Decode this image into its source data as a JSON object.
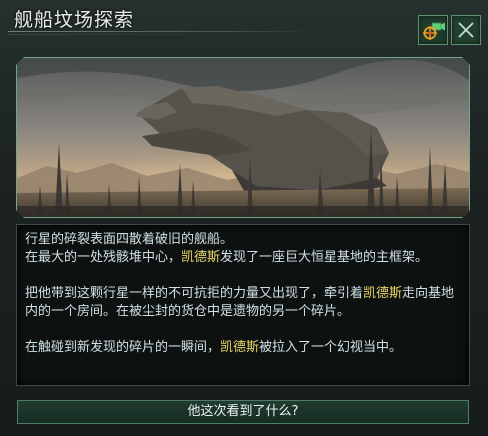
{
  "window": {
    "title": "舰船坟场探索"
  },
  "buttons": {
    "camera_icon": "camera-target-icon",
    "close_icon": "close-icon"
  },
  "description": {
    "line1": "行星的碎裂表面四散着破旧的舰船。",
    "line2_pre": "在最大的一处残骸堆中心，",
    "name": "凯德斯",
    "line2_post": "发现了一座巨大恒星基地的主框架。",
    "para2_pre": "把他带到这颗行星一样的不可抗拒的力量又出现了，牵引着",
    "para2_post": "走向基地内的一个房间。在被尘封的货仓中是遗物的另一个碎片。",
    "para3_pre": "在触碰到新发现的碎片的一瞬间，",
    "para3_post": "被拉入了一个幻视当中。"
  },
  "choices": [
    {
      "label": "他这次看到了什么?"
    }
  ],
  "colors": {
    "accent_green": "#6fa58b",
    "highlight_name": "#e8d76a",
    "text": "#cfe0e6"
  }
}
